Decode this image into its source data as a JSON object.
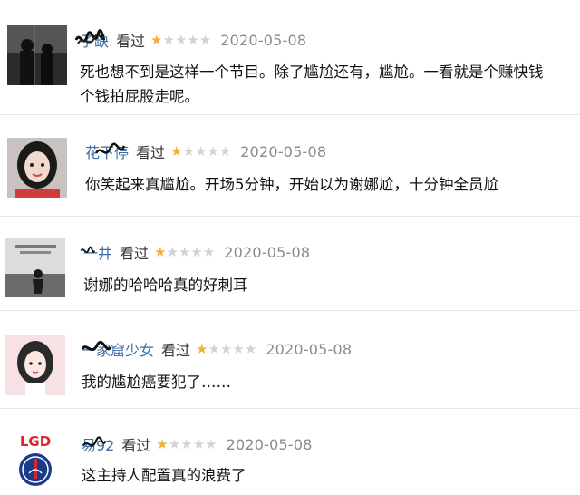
{
  "reviews": [
    {
      "username": "子缺",
      "watched_label": "看过",
      "rating": 1,
      "max_rating": 5,
      "date": "2020-05-08",
      "comment_lines": [
        "死也想不到是这样一个节目。除了尴尬还有，尴尬。一看就是个赚快钱",
        "个钱拍屁股走呢。"
      ]
    },
    {
      "username": "花下停",
      "watched_label": "看过",
      "rating": 1,
      "max_rating": 5,
      "date": "2020-05-08",
      "comment_lines": [
        "你笑起来真尴尬。开场5分钟，开始以为谢娜尬，十分钟全员尬"
      ]
    },
    {
      "username": "一井",
      "watched_label": "看过",
      "rating": 1,
      "max_rating": 5,
      "date": "2020-05-08",
      "comment_lines": [
        "谢娜的哈哈哈真的好刺耳"
      ]
    },
    {
      "username": "一家窟少女",
      "watched_label": "看过",
      "rating": 1,
      "max_rating": 5,
      "date": "2020-05-08",
      "comment_lines": [
        "我的尴尬癌要犯了……"
      ]
    },
    {
      "username": "易92",
      "watched_label": "看过",
      "rating": 1,
      "max_rating": 5,
      "date": "2020-05-08",
      "comment_lines": [
        "这主持人配置真的浪费了"
      ]
    }
  ],
  "avatar_badge_text": "LGD",
  "colors": {
    "username": "#3a6ea5",
    "star_on": "#f3b13a",
    "star_off": "#d3d3d3",
    "date": "#8a8a8a"
  }
}
